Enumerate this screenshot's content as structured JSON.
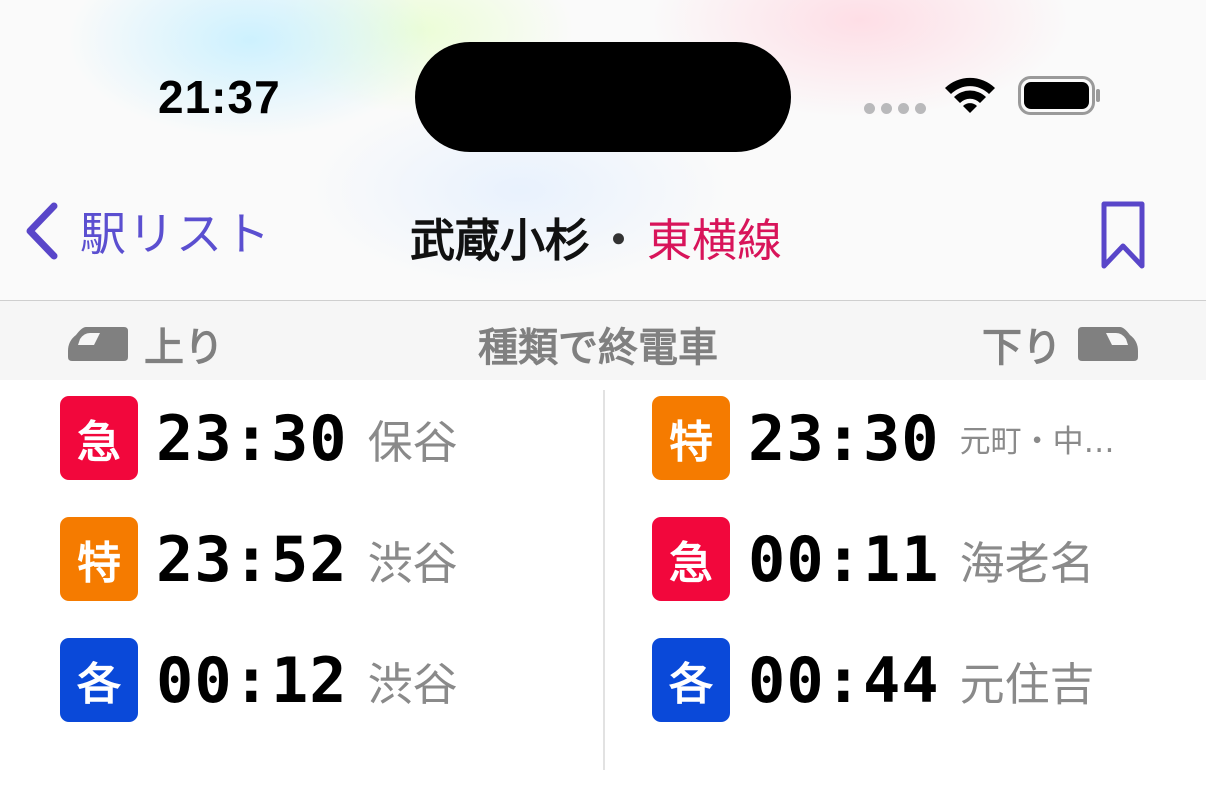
{
  "status_bar": {
    "time": "21:37"
  },
  "nav": {
    "back_label": "駅リスト",
    "title_station": "武蔵小杉",
    "title_separator": "・",
    "title_line": "東横線",
    "line_color": "#d8145a",
    "accent_color": "#5b4fd0"
  },
  "segment": {
    "up_label": "上り",
    "center_label": "種類で終電車",
    "down_label": "下り"
  },
  "colors": {
    "kyu": "#f2073c",
    "toku": "#f57b00",
    "kaku": "#0a49d9"
  },
  "up_trains": [
    {
      "type": "急",
      "time": "23:30",
      "dest": "保谷",
      "color": "#f2073c"
    },
    {
      "type": "特",
      "time": "23:52",
      "dest": "渋谷",
      "color": "#f57b00"
    },
    {
      "type": "各",
      "time": "00:12",
      "dest": "渋谷",
      "color": "#0a49d9"
    }
  ],
  "down_trains": [
    {
      "type": "特",
      "time": "23:30",
      "dest": "元町・中…",
      "color": "#f57b00"
    },
    {
      "type": "急",
      "time": "00:11",
      "dest": "海老名",
      "color": "#f2073c"
    },
    {
      "type": "各",
      "time": "00:44",
      "dest": "元住吉",
      "color": "#0a49d9"
    }
  ]
}
